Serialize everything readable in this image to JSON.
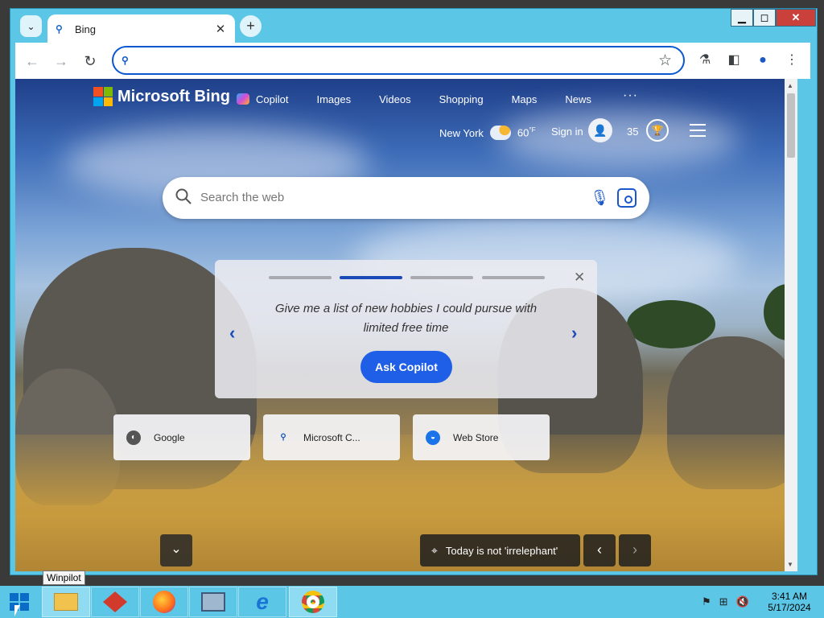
{
  "browser": {
    "tab_title": "Bing",
    "tab_icon": "search-icon",
    "address_value": "",
    "window_controls": {
      "minimize": "▁",
      "maximize": "◻",
      "close": "✕"
    }
  },
  "bing": {
    "brand": "Microsoft Bing",
    "nav": [
      "Copilot",
      "Images",
      "Videos",
      "Shopping",
      "Maps",
      "News"
    ],
    "more": "···",
    "weather_city": "New York",
    "weather_temp": "60",
    "weather_unit": "°F",
    "sign_in": "Sign in",
    "points": "35",
    "search_placeholder": "Search the web",
    "copilot_card": {
      "prompt": "Give me a list of new hobbies I could pursue with limited free time",
      "button": "Ask Copilot",
      "active_dot": 2,
      "dot_count": 4
    },
    "quick_links": [
      "Google",
      "Microsoft C...",
      "Web Store"
    ],
    "caption": "Today is not 'irrelephant'"
  },
  "taskbar": {
    "tooltip": "Winpilot",
    "time": "3:41 AM",
    "date": "5/17/2024"
  },
  "colors": {
    "accent": "#1a4ab8",
    "window_frame": "#5cc6e6",
    "ask_button": "#1f5ee6",
    "ms_red": "#f25022",
    "ms_green": "#7fba00",
    "ms_blue": "#00a4ef",
    "ms_yellow": "#ffb900"
  }
}
